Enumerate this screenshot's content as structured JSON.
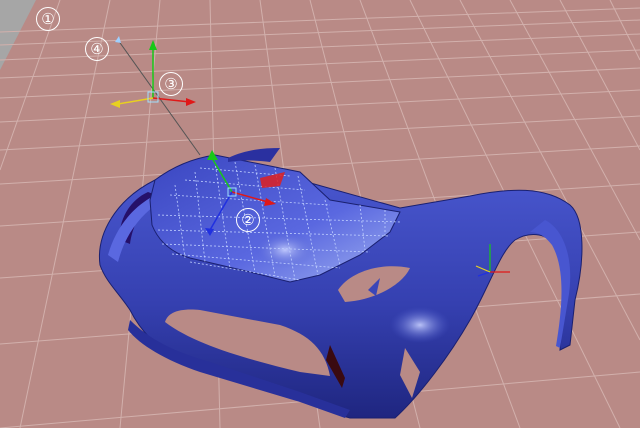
{
  "viewport": {
    "background_color": "#b98a86",
    "grid_color": "#c9a6a2",
    "model_color": "#3a46b8"
  },
  "callouts": [
    {
      "label": "①"
    },
    {
      "label": "②"
    },
    {
      "label": "③"
    },
    {
      "label": "④"
    }
  ],
  "gizmo_axes": {
    "x_color": "#e01818",
    "y_color": "#18c818",
    "z_color": "#2030e0",
    "extra_color": "#e8d020"
  },
  "icons": [
    "move-gizmo-icon",
    "axis-tripod-icon",
    "pivot-icon",
    "camera-target-icon"
  ]
}
